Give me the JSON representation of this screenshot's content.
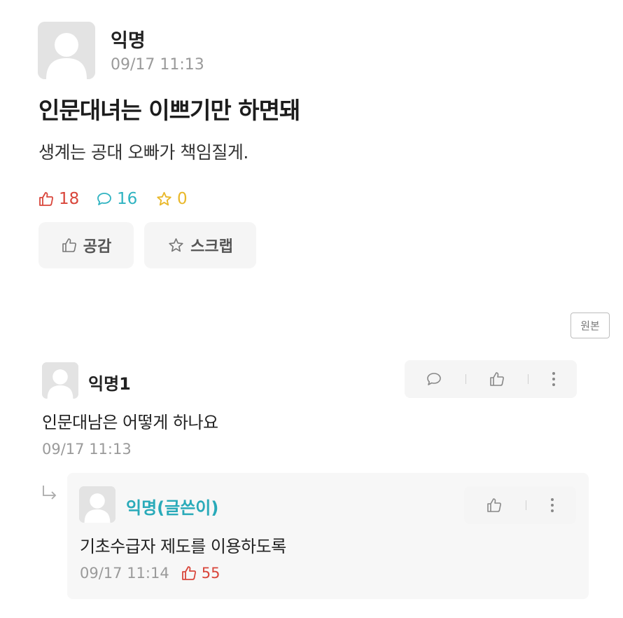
{
  "post": {
    "author": "익명",
    "time": "09/17 11:13",
    "title": "인문대녀는 이쁘기만 하면돼",
    "body": "생계는 공대 오빠가 책임질게.",
    "stats": {
      "likes": "18",
      "comments": "16",
      "scraps": "0"
    },
    "actions": {
      "like_label": "공감",
      "scrap_label": "스크랩"
    }
  },
  "origin_button": "원본",
  "comments": [
    {
      "author": "익명1",
      "text": "인문대남은 어떻게 하나요",
      "time": "09/17 11:13",
      "reply": {
        "author": "익명(글쓴이)",
        "text": "기초수급자 제도를 이용하도록",
        "time": "09/17 11:14",
        "likes": "55"
      }
    }
  ],
  "colors": {
    "like_red": "#d9463b",
    "comment_teal": "#2fb3c1",
    "scrap_yellow": "#e9b82a",
    "author_teal": "#29aab9",
    "meta_gray": "#9a9a9a"
  }
}
